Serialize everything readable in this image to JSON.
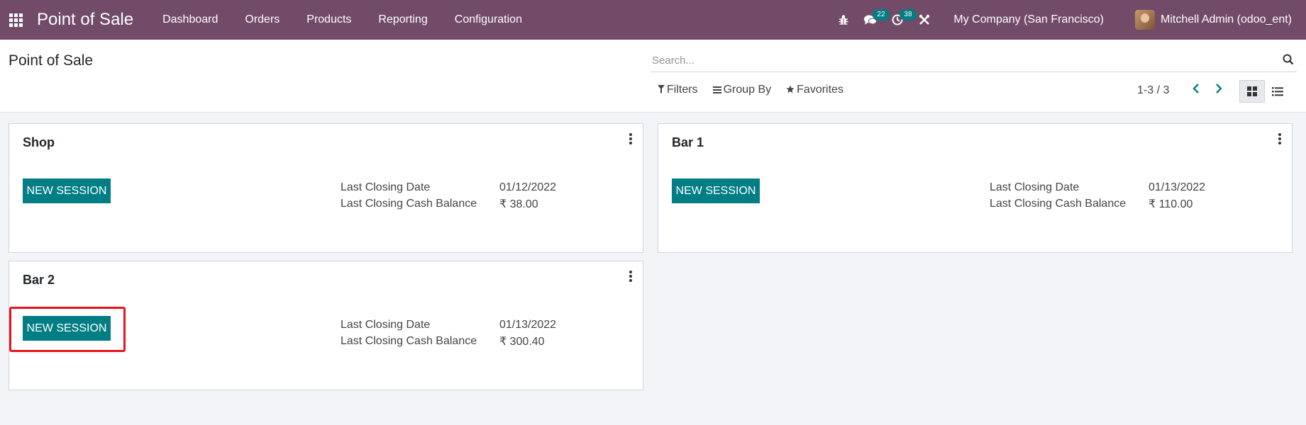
{
  "navbar": {
    "app_title": "Point of Sale",
    "menu": [
      "Dashboard",
      "Orders",
      "Products",
      "Reporting",
      "Configuration"
    ],
    "messages_count": "22",
    "activities_count": "38",
    "company": "My Company (San Francisco)",
    "user": "Mitchell Admin (odoo_ent)"
  },
  "control_panel": {
    "title": "Point of Sale",
    "search_placeholder": "Search...",
    "filters_label": "Filters",
    "groupby_label": "Group By",
    "favorites_label": "Favorites",
    "pager_value": "1-3 / 3"
  },
  "cards": [
    {
      "name": "Shop",
      "button_label": "NEW SESSION",
      "closing_date_label": "Last Closing Date",
      "closing_date": "01/12/2022",
      "cash_balance_label": "Last Closing Cash Balance",
      "cash_balance": "₹ 38.00"
    },
    {
      "name": "Bar 1",
      "button_label": "NEW SESSION",
      "closing_date_label": "Last Closing Date",
      "closing_date": "01/13/2022",
      "cash_balance_label": "Last Closing Cash Balance",
      "cash_balance": "₹ 110.00"
    },
    {
      "name": "Bar 2",
      "button_label": "NEW SESSION",
      "closing_date_label": "Last Closing Date",
      "closing_date": "01/13/2022",
      "cash_balance_label": "Last Closing Cash Balance",
      "cash_balance": "₹ 300.40"
    }
  ],
  "colors": {
    "navbar": "#714b67",
    "accent": "#017e84",
    "highlight": "#e8141b"
  },
  "icons": [
    "apps-grid-icon",
    "bug-icon",
    "chat-icon",
    "clock-icon",
    "tools-icon",
    "search-icon",
    "filter-icon",
    "list-lines-icon",
    "star-icon",
    "chevron-left-icon",
    "chevron-right-icon",
    "kanban-view-icon",
    "list-view-icon",
    "kebab-menu-icon"
  ]
}
